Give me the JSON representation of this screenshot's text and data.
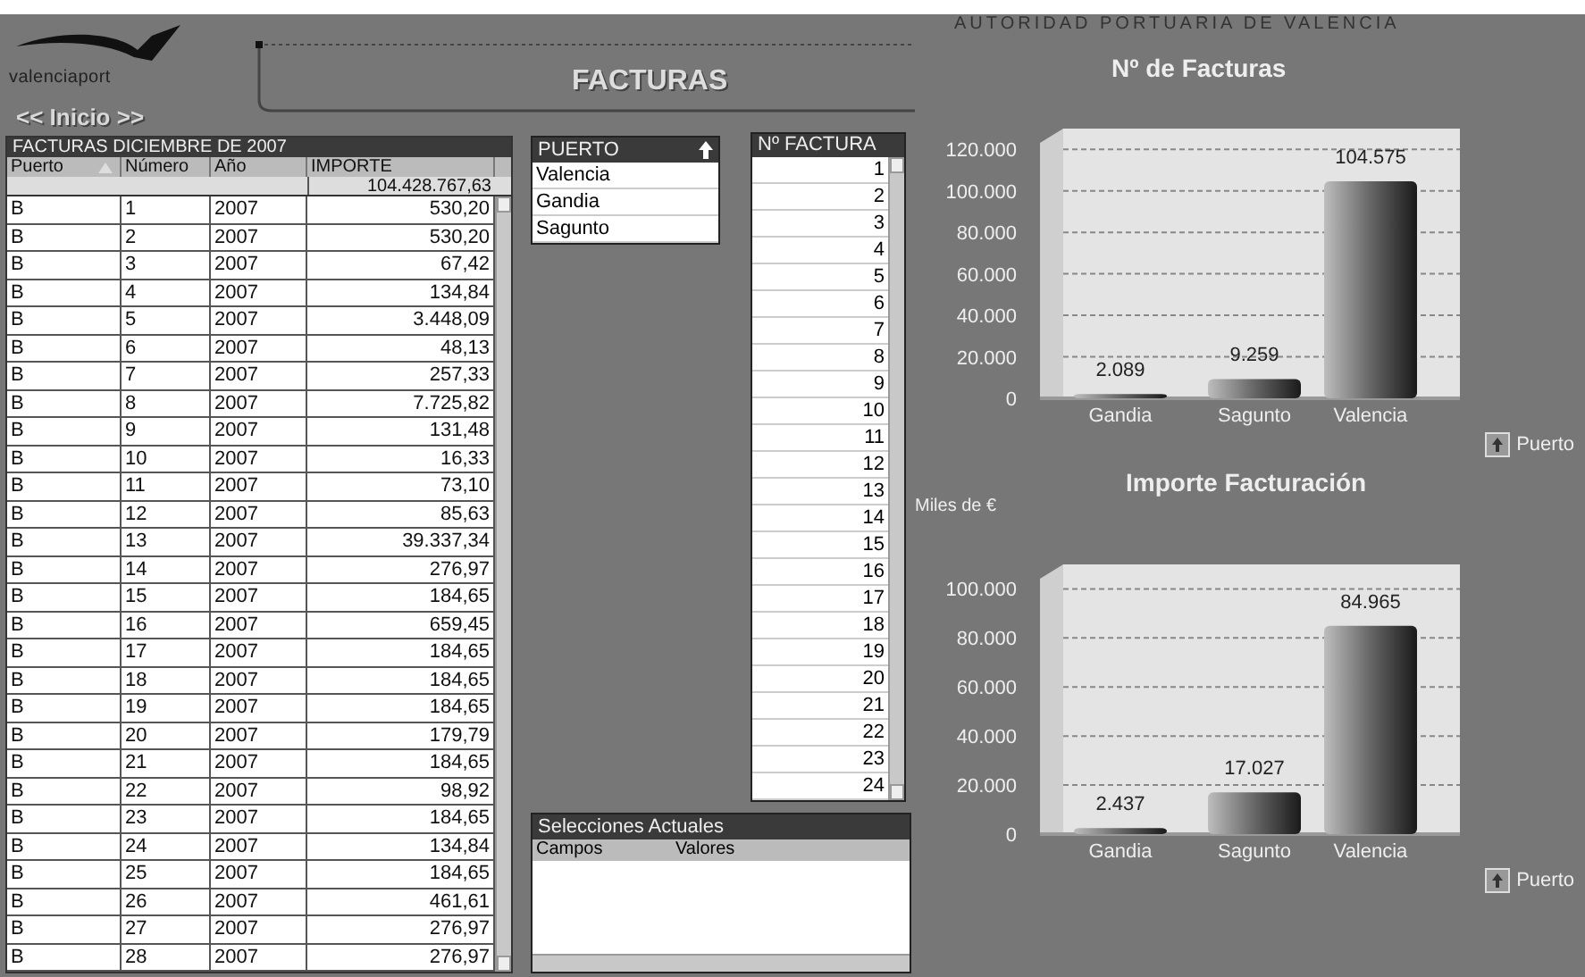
{
  "logo": {
    "text": "valenciaport"
  },
  "nav": {
    "label": "<< Inicio >>"
  },
  "page_title": "FACTURAS",
  "organization": "AUTORIDAD PORTUARIA DE VALENCIA",
  "table": {
    "title": "FACTURAS DICIEMBRE DE 2007",
    "columns": [
      "Puerto",
      "Número",
      "Año",
      "IMPORTE"
    ],
    "total": "104.428.767,63",
    "rows": [
      [
        "B",
        "1",
        "2007",
        "530,20"
      ],
      [
        "B",
        "2",
        "2007",
        "530,20"
      ],
      [
        "B",
        "3",
        "2007",
        "67,42"
      ],
      [
        "B",
        "4",
        "2007",
        "134,84"
      ],
      [
        "B",
        "5",
        "2007",
        "3.448,09"
      ],
      [
        "B",
        "6",
        "2007",
        "48,13"
      ],
      [
        "B",
        "7",
        "2007",
        "257,33"
      ],
      [
        "B",
        "8",
        "2007",
        "7.725,82"
      ],
      [
        "B",
        "9",
        "2007",
        "131,48"
      ],
      [
        "B",
        "10",
        "2007",
        "16,33"
      ],
      [
        "B",
        "11",
        "2007",
        "73,10"
      ],
      [
        "B",
        "12",
        "2007",
        "85,63"
      ],
      [
        "B",
        "13",
        "2007",
        "39.337,34"
      ],
      [
        "B",
        "14",
        "2007",
        "276,97"
      ],
      [
        "B",
        "15",
        "2007",
        "184,65"
      ],
      [
        "B",
        "16",
        "2007",
        "659,45"
      ],
      [
        "B",
        "17",
        "2007",
        "184,65"
      ],
      [
        "B",
        "18",
        "2007",
        "184,65"
      ],
      [
        "B",
        "19",
        "2007",
        "184,65"
      ],
      [
        "B",
        "20",
        "2007",
        "179,79"
      ],
      [
        "B",
        "21",
        "2007",
        "184,65"
      ],
      [
        "B",
        "22",
        "2007",
        "98,92"
      ],
      [
        "B",
        "23",
        "2007",
        "184,65"
      ],
      [
        "B",
        "24",
        "2007",
        "134,84"
      ],
      [
        "B",
        "25",
        "2007",
        "184,65"
      ],
      [
        "B",
        "26",
        "2007",
        "461,61"
      ],
      [
        "B",
        "27",
        "2007",
        "276,97"
      ],
      [
        "B",
        "28",
        "2007",
        "276,97"
      ]
    ]
  },
  "puerto_list": {
    "title": "PUERTO",
    "items": [
      "Valencia",
      "Gandia",
      "Sagunto"
    ]
  },
  "factura_list": {
    "title": "Nº FACTURA",
    "items": [
      "1",
      "2",
      "3",
      "4",
      "5",
      "6",
      "7",
      "8",
      "9",
      "10",
      "11",
      "12",
      "13",
      "14",
      "15",
      "16",
      "17",
      "18",
      "19",
      "20",
      "21",
      "22",
      "23",
      "24"
    ]
  },
  "current_selections": {
    "title": "Selecciones Actuales",
    "columns": [
      "Campos",
      "Valores"
    ]
  },
  "charts": [
    {
      "chart_data": {
        "type": "bar",
        "grid": true,
        "title": "Nº de Facturas",
        "xlabel": "Puerto",
        "categories": [
          "Gandia",
          "Sagunto",
          "Valencia"
        ],
        "values": [
          2089,
          9259,
          104575
        ],
        "value_labels": [
          "2.089",
          "9.259",
          "104.575"
        ],
        "ylim": [
          0,
          130000
        ],
        "yticks": [
          {
            "value": 0,
            "label": "0"
          },
          {
            "value": 20000,
            "label": "20.000"
          },
          {
            "value": 40000,
            "label": "40.000"
          },
          {
            "value": 60000,
            "label": "60.000"
          },
          {
            "value": 80000,
            "label": "80.000"
          },
          {
            "value": 100000,
            "label": "100.000"
          },
          {
            "value": 120000,
            "label": "120.000"
          }
        ]
      }
    },
    {
      "chart_data": {
        "type": "bar",
        "grid": true,
        "title": "Importe Facturación",
        "ylabel": "Miles de €",
        "xlabel": "Puerto",
        "categories": [
          "Gandia",
          "Sagunto",
          "Valencia"
        ],
        "values": [
          2437,
          17027,
          84965
        ],
        "value_labels": [
          "2.437",
          "17.027",
          "84.965"
        ],
        "ylim": [
          0,
          110000
        ],
        "yticks": [
          {
            "value": 0,
            "label": "0"
          },
          {
            "value": 20000,
            "label": "20.000"
          },
          {
            "value": 40000,
            "label": "40.000"
          },
          {
            "value": 60000,
            "label": "60.000"
          },
          {
            "value": 80000,
            "label": "80.000"
          },
          {
            "value": 100000,
            "label": "100.000"
          }
        ]
      }
    }
  ]
}
